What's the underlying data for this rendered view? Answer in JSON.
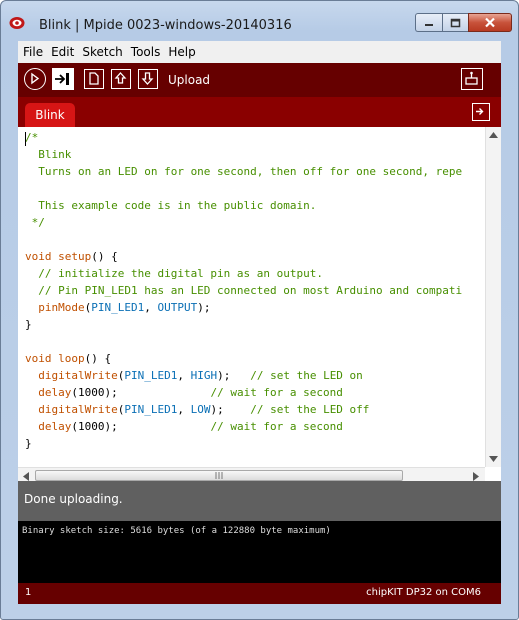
{
  "window": {
    "title": "Blink | Mpide 0023-windows-20140316"
  },
  "menu": [
    "File",
    "Edit",
    "Sketch",
    "Tools",
    "Help"
  ],
  "toolbar": {
    "hover_label": "Upload"
  },
  "tab": {
    "label": "Blink"
  },
  "code": [
    [
      {
        "t": "/*",
        "c": "comment"
      }
    ],
    [
      {
        "t": "  Blink",
        "c": "comment"
      }
    ],
    [
      {
        "t": "  Turns on an LED on for one second, then off for one second, repe",
        "c": "comment"
      }
    ],
    [],
    [
      {
        "t": "  This example code is in the public domain.",
        "c": "comment"
      }
    ],
    [
      {
        "t": " */",
        "c": "comment"
      }
    ],
    [],
    [
      {
        "t": "void",
        "c": "kw"
      },
      {
        "t": " ",
        "c": "plain"
      },
      {
        "t": "setup",
        "c": "fn"
      },
      {
        "t": "() {",
        "c": "plain"
      }
    ],
    [
      {
        "t": "  // initialize the digital pin as an output.",
        "c": "comment"
      }
    ],
    [
      {
        "t": "  // Pin PIN_LED1 has an LED connected on most Arduino and compati",
        "c": "comment"
      }
    ],
    [
      {
        "t": "  ",
        "c": "plain"
      },
      {
        "t": "pinMode",
        "c": "fn"
      },
      {
        "t": "(",
        "c": "plain"
      },
      {
        "t": "PIN_LED1",
        "c": "const"
      },
      {
        "t": ", ",
        "c": "plain"
      },
      {
        "t": "OUTPUT",
        "c": "const"
      },
      {
        "t": ");",
        "c": "plain"
      }
    ],
    [
      {
        "t": "}",
        "c": "plain"
      }
    ],
    [],
    [
      {
        "t": "void",
        "c": "kw"
      },
      {
        "t": " ",
        "c": "plain"
      },
      {
        "t": "loop",
        "c": "fn"
      },
      {
        "t": "() {",
        "c": "plain"
      }
    ],
    [
      {
        "t": "  ",
        "c": "plain"
      },
      {
        "t": "digitalWrite",
        "c": "fn"
      },
      {
        "t": "(",
        "c": "plain"
      },
      {
        "t": "PIN_LED1",
        "c": "const"
      },
      {
        "t": ", ",
        "c": "plain"
      },
      {
        "t": "HIGH",
        "c": "const"
      },
      {
        "t": ");   ",
        "c": "plain"
      },
      {
        "t": "// set the LED on",
        "c": "comment"
      }
    ],
    [
      {
        "t": "  ",
        "c": "plain"
      },
      {
        "t": "delay",
        "c": "fn"
      },
      {
        "t": "(1000);              ",
        "c": "plain"
      },
      {
        "t": "// wait for a second",
        "c": "comment"
      }
    ],
    [
      {
        "t": "  ",
        "c": "plain"
      },
      {
        "t": "digitalWrite",
        "c": "fn"
      },
      {
        "t": "(",
        "c": "plain"
      },
      {
        "t": "PIN_LED1",
        "c": "const"
      },
      {
        "t": ", ",
        "c": "plain"
      },
      {
        "t": "LOW",
        "c": "const"
      },
      {
        "t": ");    ",
        "c": "plain"
      },
      {
        "t": "// set the LED off",
        "c": "comment"
      }
    ],
    [
      {
        "t": "  ",
        "c": "plain"
      },
      {
        "t": "delay",
        "c": "fn"
      },
      {
        "t": "(1000);              ",
        "c": "plain"
      },
      {
        "t": "// wait for a second",
        "c": "comment"
      }
    ],
    [
      {
        "t": "}",
        "c": "plain"
      }
    ]
  ],
  "status": {
    "message": "Done uploading."
  },
  "console": {
    "output": "Binary sketch size: 5616 bytes (of a 122880 byte maximum)"
  },
  "footer": {
    "line_number": "1",
    "board": "chipKIT DP32 on COM6"
  },
  "colors": {
    "toolbar_bg": "#660000",
    "tab_active": "#d61515",
    "comment": "#478f00",
    "keyword": "#c05000",
    "constant": "#0a6fb5"
  }
}
